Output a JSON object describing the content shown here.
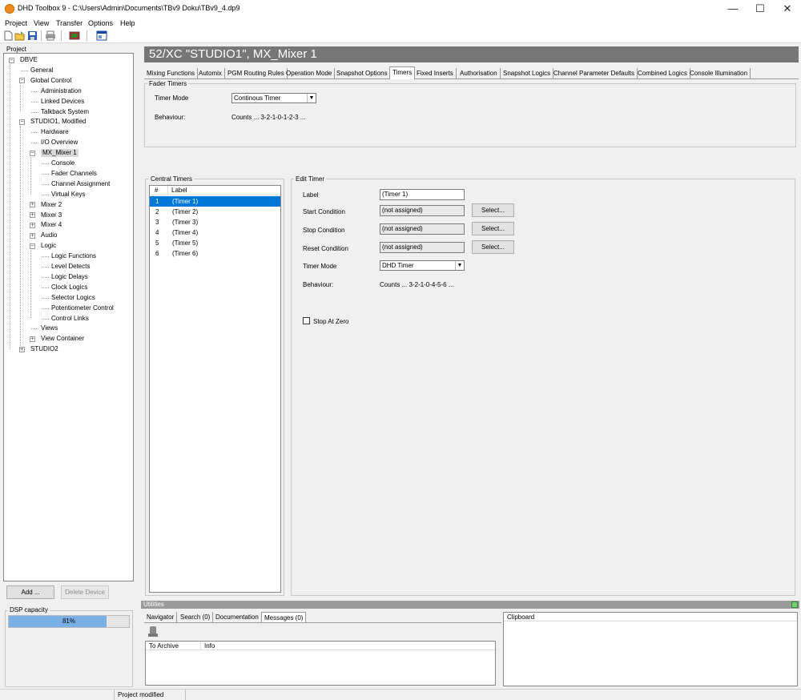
{
  "window": {
    "title": "DHD Toolbox 9 - C:\\Users\\Admin\\Documents\\TBv9 Doku\\TBv9_4.dp9",
    "minimize": "—",
    "maximize": "☐",
    "close": "✕"
  },
  "menu": [
    "Project",
    "View",
    "Transfer",
    "Options",
    "Help"
  ],
  "project_panel": {
    "title": "Project",
    "tree": [
      {
        "label": "DBVE",
        "exp": "−"
      },
      {
        "label": "General"
      },
      {
        "label": "Global Control",
        "exp": "−"
      },
      {
        "label": "Administration"
      },
      {
        "label": "Linked Devices"
      },
      {
        "label": "Talkback System"
      },
      {
        "label": "STUDIO1, Modified",
        "exp": "−"
      },
      {
        "label": "Hardware"
      },
      {
        "label": "I/O Overview"
      },
      {
        "label": "MX_Mixer 1",
        "exp": "−"
      },
      {
        "label": "Console"
      },
      {
        "label": "Fader Channels"
      },
      {
        "label": "Channel Assignment"
      },
      {
        "label": "Virtual Keys"
      },
      {
        "label": "Mixer 2",
        "exp": "+"
      },
      {
        "label": "Mixer 3",
        "exp": "+"
      },
      {
        "label": "Mixer 4",
        "exp": "+"
      },
      {
        "label": "Audio",
        "exp": "+"
      },
      {
        "label": "Logic",
        "exp": "−"
      },
      {
        "label": "Logic Functions"
      },
      {
        "label": "Level Detects"
      },
      {
        "label": "Logic Delays"
      },
      {
        "label": "Clock Logics"
      },
      {
        "label": "Selector Logics"
      },
      {
        "label": "Potentiometer Control"
      },
      {
        "label": "Control Links"
      },
      {
        "label": "Views"
      },
      {
        "label": "View Container",
        "exp": "+"
      },
      {
        "label": "STUDIO2",
        "exp": "+"
      }
    ],
    "add_button": "Add ...",
    "delete_button": "Delete Device",
    "dsp_title": "DSP capacity",
    "dsp_value": "81%",
    "dsp_fraction": 0.81
  },
  "device_header": "52/XC \"STUDIO1\", MX_Mixer 1",
  "tabs": [
    "Mixing Functions",
    "Automix",
    "PGM Routing Rules",
    "Operation Mode",
    "Snapshot Options",
    "Timers",
    "Fixed Inserts",
    "Authorisation",
    "Snapshot Logics",
    "Channel Parameter Defaults",
    "Combined Logics",
    "Console Illumination"
  ],
  "active_tab": "Timers",
  "fader_timers": {
    "title": "Fader Timers",
    "timer_mode_label": "Timer Mode",
    "timer_mode_value": "Continous Timer",
    "behaviour_label": "Behaviour:",
    "behaviour_value": "Counts ... 3-2-1-0-1-2-3 ..."
  },
  "central_timers": {
    "title": "Central Timers",
    "col_num": "#",
    "col_label": "Label",
    "rows": [
      {
        "num": "1",
        "label": "(Timer 1)"
      },
      {
        "num": "2",
        "label": "(Timer 2)"
      },
      {
        "num": "3",
        "label": "(Timer 3)"
      },
      {
        "num": "4",
        "label": "(Timer 4)"
      },
      {
        "num": "5",
        "label": "(Timer 5)"
      },
      {
        "num": "6",
        "label": "(Timer 6)"
      }
    ]
  },
  "edit_timer": {
    "title": "Edit Timer",
    "label_label": "Label",
    "label_value": "(Timer 1)",
    "start_label": "Start Condition",
    "start_value": "(not assigned)",
    "stop_label": "Stop Condition",
    "stop_value": "(not assigned)",
    "reset_label": "Reset Condition",
    "reset_value": "(not assigned)",
    "select_button": "Select...",
    "mode_label": "Timer Mode",
    "mode_value": "DHD Timer",
    "behaviour_label": "Behaviour:",
    "behaviour_value": "Counts ... 3-2-1-0-4-5-6 ...",
    "stop_at_zero": "Stop At Zero"
  },
  "utilities": {
    "title": "Utilities",
    "tabs": [
      "Navigator",
      "Search (0)",
      "Documentation",
      "Messages (0)"
    ],
    "active_tab": "Messages (0)",
    "col_archive": "To Archive",
    "col_info": "Info",
    "clipboard": "Clipboard"
  },
  "status": {
    "text": "Project modified"
  }
}
